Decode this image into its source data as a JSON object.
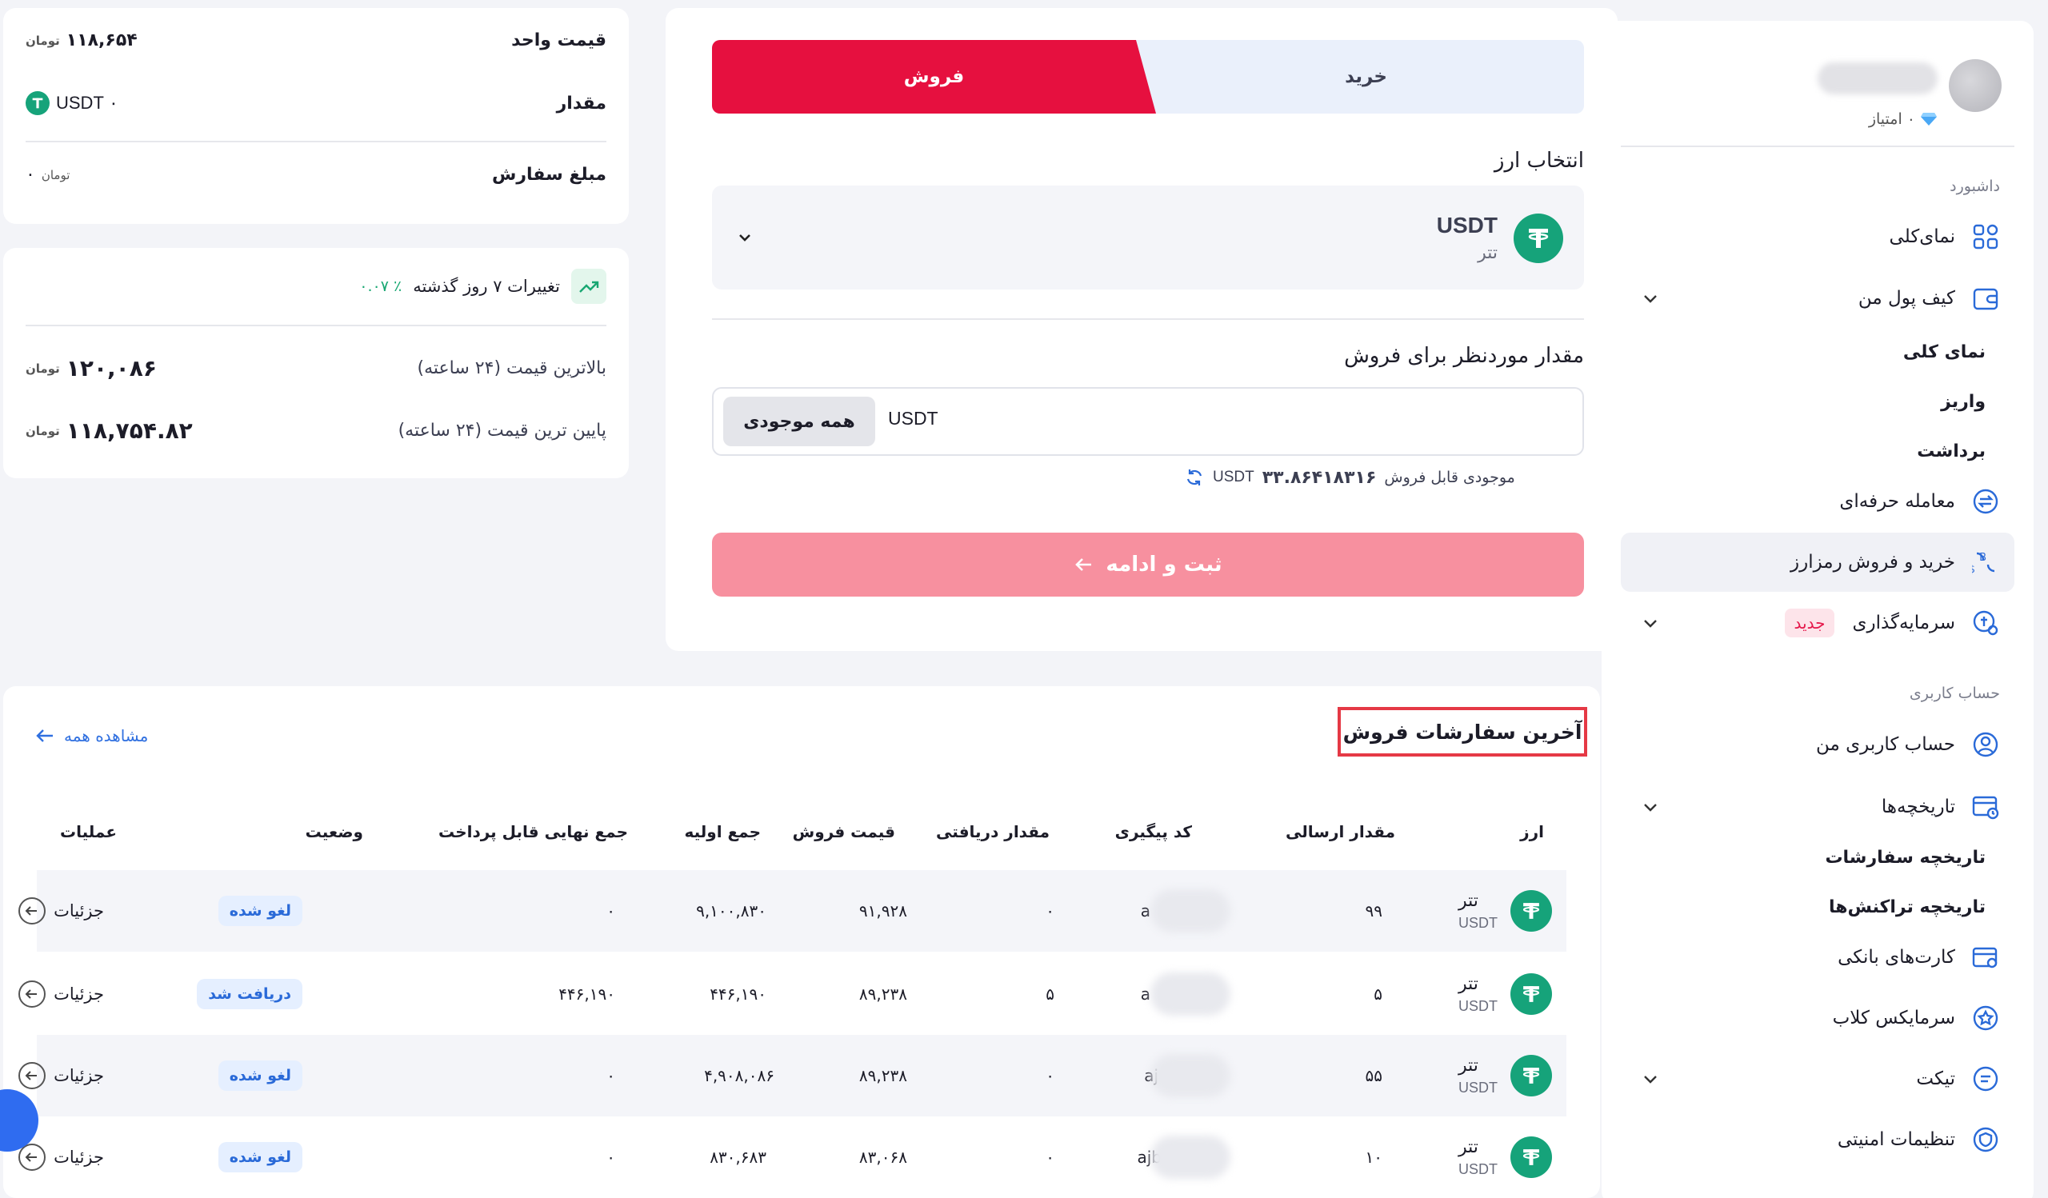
{
  "sidebar": {
    "points_label": "۰ امتیاز",
    "section_dashboard": "داشبورد",
    "section_account": "حساب کاربری",
    "items": {
      "overview": "نمای‌کلی",
      "wallet": "کیف پول من",
      "wallet_overview": "نمای کلی",
      "deposit": "واریز",
      "withdraw": "برداشت",
      "pro_trade": "معامله حرفه‌ای",
      "buy_sell": "خرید و فروش رمزارز",
      "investment": "سرمایه‌گذاری",
      "new_badge": "جدید",
      "my_account": "حساب کاربری من",
      "histories": "تاریخچه‌ها",
      "order_history": "تاریخچه سفارشات",
      "tx_history": "تاریخچه تراکنش‌ها",
      "bank_cards": "کارت‌های بانکی",
      "club": "سرمایکس کلاب",
      "ticket": "تیکت",
      "security": "تنظیمات امنیتی"
    }
  },
  "trade": {
    "tab_buy": "خرید",
    "tab_sell": "فروش",
    "select_label": "انتخاب ارز",
    "coin_symbol": "USDT",
    "coin_name": "تتر",
    "amount_label": "مقدار موردنظر برای فروش",
    "amount_unit": "USDT",
    "all_balance": "همه موجودی",
    "available_label": "موجودی قابل فروش",
    "available_value": "۳۳.۸۶۴۱۸۳۱۶",
    "available_unit": "USDT",
    "submit": "ثبت و ادامه"
  },
  "price_card": {
    "unit_price_label": "قیمت واحد",
    "unit_price_value": "۱۱۸,۶۵۴",
    "amount_label": "مقدار",
    "amount_value": "۰ USDT",
    "order_amount_label": "مبلغ سفارش",
    "order_amount_value": "۰",
    "toman": "تومان"
  },
  "changes_card": {
    "title": "تغییرات ۷ روز گذشته",
    "percent": "٪ ۰.۰۷",
    "high_label": "بالاترین قیمت (۲۴ ساعته)",
    "high_value": "۱۲۰,۰۸۶",
    "low_label": "پایین ترین قیمت (۲۴ ساعته)",
    "low_value": "۱۱۸,۷۵۴.۸۲",
    "toman": "تومان"
  },
  "orders": {
    "title": "آخرین سفارشات فروش",
    "see_all": "مشاهده همه",
    "headers": [
      "ارز",
      "مقدار ارسالی",
      "کد پیگیری",
      "مقدار دریافتی",
      "قیمت فروش",
      "جمع اولیه",
      "جمع نهایی قابل پرداخت",
      "وضعیت",
      "عملیات"
    ],
    "rows": [
      {
        "coin_fa": "تتر",
        "coin_en": "USDT",
        "sent": "۹۹",
        "code": "a",
        "received": "۰",
        "price": "۹۱,۹۲۸",
        "initial": "۹,۱۰۰,۸۳۰",
        "final": "۰",
        "status": "لغو شده",
        "action": "جزئیات"
      },
      {
        "coin_fa": "تتر",
        "coin_en": "USDT",
        "sent": "۵",
        "code": "a",
        "received": "۵",
        "price": "۸۹,۲۳۸",
        "initial": "۴۴۶,۱۹۰",
        "final": "۴۴۶,۱۹۰",
        "status": "دریافت شد",
        "action": "جزئیات"
      },
      {
        "coin_fa": "تتر",
        "coin_en": "USDT",
        "sent": "۵۵",
        "code": "aj",
        "received": "۰",
        "price": "۸۹,۲۳۸",
        "initial": "۴,۹۰۸,۰۸۶",
        "final": "۰",
        "status": "لغو شده",
        "action": "جزئیات"
      },
      {
        "coin_fa": "تتر",
        "coin_en": "USDT",
        "sent": "۱۰",
        "code": "ajb",
        "received": "۰",
        "price": "۸۳,۰۶۸",
        "initial": "۸۳۰,۶۸۳",
        "final": "۰",
        "status": "لغو شده",
        "action": "جزئیات"
      }
    ]
  },
  "colors": {
    "accent_red": "#e6103f",
    "submit_pink": "#f7909f",
    "tether_green": "#16a37a",
    "link_blue": "#3070e0"
  }
}
